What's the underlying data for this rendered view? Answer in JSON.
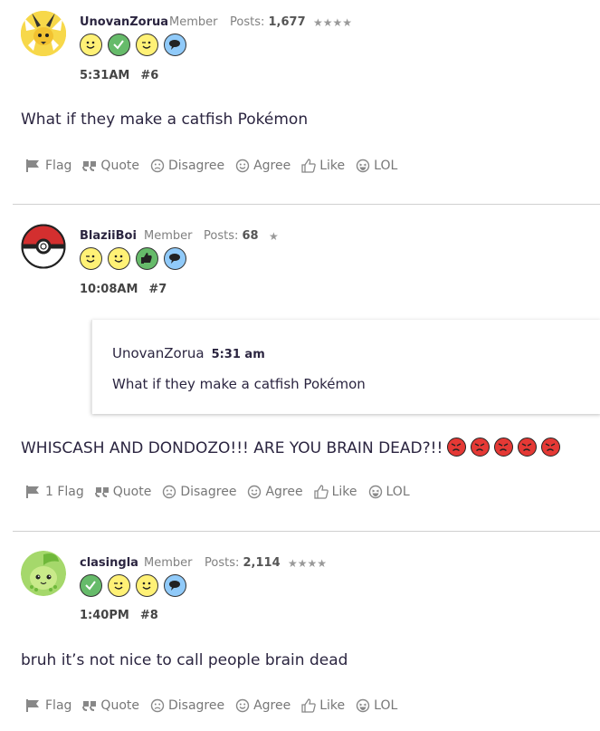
{
  "posts": [
    {
      "username": "UnovanZorua",
      "role": "Member",
      "posts_label": "Posts:",
      "posts_count": "1,677",
      "stars": "★★★★",
      "time": "5:31AM",
      "number": "#6",
      "body": "What if they make a catfish Pokémon",
      "actions": {
        "flag": "Flag",
        "quote": "Quote",
        "disagree": "Disagree",
        "agree": "Agree",
        "like": "Like",
        "lol": "LOL"
      }
    },
    {
      "username": "BlaziiBoi",
      "role": "Member",
      "posts_label": "Posts:",
      "posts_count": "68",
      "stars": "★",
      "time": "10:08AM",
      "number": "#7",
      "quote_author": "UnovanZorua",
      "quote_time": "5:31 am",
      "quote_body": "What if they make a catfish Pokémon",
      "body": "WHISCASH AND DONDOZO!!! ARE YOU BRAIN DEAD?!!",
      "actions": {
        "flag": "1 Flag",
        "quote": "Quote",
        "disagree": "Disagree",
        "agree": "Agree",
        "like": "Like",
        "lol": "LOL"
      }
    },
    {
      "username": "clasingla",
      "role": "Member",
      "posts_label": "Posts:",
      "posts_count": "2,114",
      "stars": "★★★★",
      "time": "1:40PM",
      "number": "#8",
      "body": "bruh it’s not nice to call people brain dead",
      "actions": {
        "flag": "Flag",
        "quote": "Quote",
        "disagree": "Disagree",
        "agree": "Agree",
        "like": "Like",
        "lol": "LOL"
      }
    }
  ],
  "colors": {
    "smiley_yellow": "#fff176",
    "check_green": "#66bb6a",
    "speech_blue": "#90caf9",
    "angry_red": "#e53935"
  },
  "icons": [
    "flag-icon",
    "quote-icon",
    "disagree-icon",
    "agree-icon",
    "like-icon",
    "lol-icon",
    "jolteon-avatar",
    "pokeball-avatar",
    "chikorita-avatar"
  ]
}
